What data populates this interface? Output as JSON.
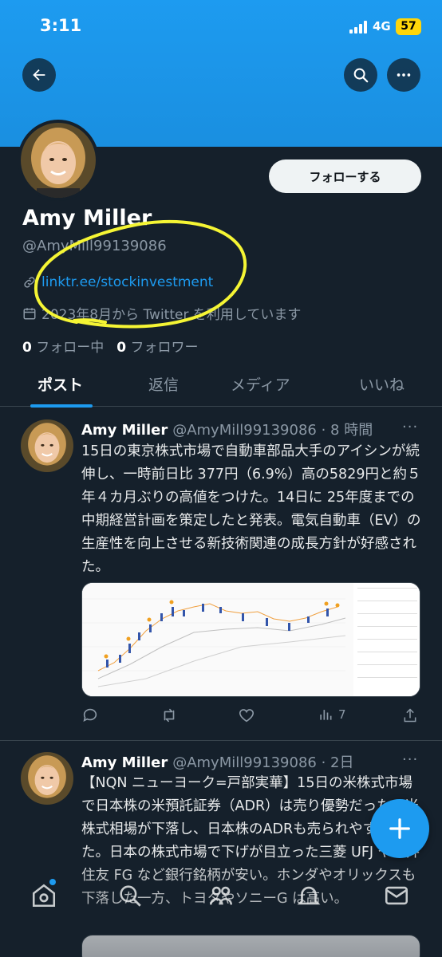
{
  "status": {
    "time": "3:11",
    "network": "4G",
    "battery": "57"
  },
  "profile": {
    "follow_label": "フォローする",
    "name": "Amy Miller",
    "handle": "@AmyMill99139086",
    "link": "linktr.ee/stockinvestment",
    "joined": "2023年8月から Twitter を利用しています",
    "following_count": "0",
    "following_label": "フォロー中",
    "followers_count": "0",
    "followers_label": "フォロワー"
  },
  "tabs": [
    {
      "label": "ポスト"
    },
    {
      "label": "返信"
    },
    {
      "label": "メディア"
    },
    {
      "label": "いいね"
    }
  ],
  "tweets": [
    {
      "name": "Amy Miller",
      "handle_time": "@AmyMill99139086 · 8 時間",
      "text": "15日の東京株式市場で自動車部品大手のアイシンが続伸し、一時前日比 377円（6.9%）高の5829円と約５年４カ月ぶりの高値をつけた。14日に 25年度までの中期経営計画を策定したと発表。電気自動車（EV）の生産性を向上させる新技術関連の成長方針が好感された。",
      "views": "7"
    },
    {
      "name": "Amy Miller",
      "handle_time": "@AmyMill99139086 · 2日",
      "text": "【NQN ニューヨーク=戸部実華】15日の米株式市場で日本株の米預託証券（ADR）は売り優勢だった。米株式相場が下落し、日本株のADRも売られやすかった。日本の株式市場で下げが目立った三菱 UFJ や三井住友 FG など銀行銘柄が安い。ホンダやオリックスも下落した一方、トヨタやソニーG は高い。"
    }
  ],
  "colors": {
    "accent": "#1d9bf0",
    "background": "#15202b",
    "annotation": "#f5f534"
  },
  "icons": [
    "back-arrow-icon",
    "search-icon",
    "more-icon",
    "link-icon",
    "calendar-icon",
    "reply-icon",
    "retweet-icon",
    "like-icon",
    "views-icon",
    "share-icon",
    "plus-icon",
    "home-icon",
    "explore-icon",
    "communities-icon",
    "notifications-icon",
    "messages-icon"
  ]
}
